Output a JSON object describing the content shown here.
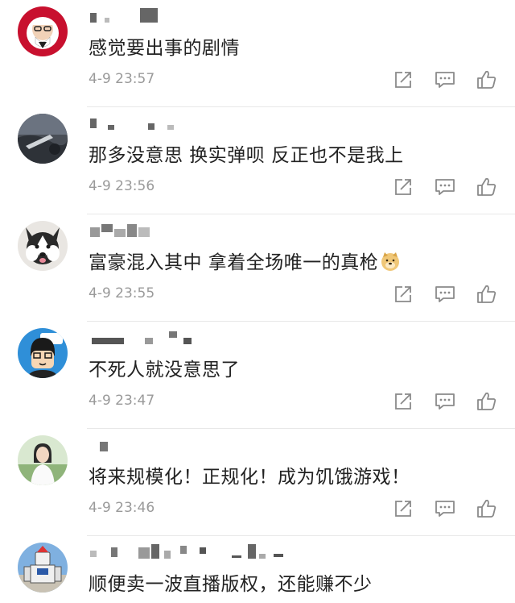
{
  "comments": [
    {
      "text": "感觉要出事的剧情",
      "time": "4-9 23:57",
      "avatar": "kfc-colonel-avatar"
    },
    {
      "text": "那多没意思 换实弹呗 反正也不是我上",
      "time": "4-9 23:56",
      "avatar": "dark-photo-avatar"
    },
    {
      "text": "富豪混入其中 拿着全场唯一的真枪",
      "time": "4-9 23:55",
      "avatar": "husky-dog-avatar",
      "emoji": "doge-emoji"
    },
    {
      "text": "不死人就没意思了",
      "time": "4-9 23:47",
      "avatar": "cartoon-boy-avatar"
    },
    {
      "text": "将来规模化！正规化！成为饥饿游戏！",
      "time": "4-9 23:46",
      "avatar": "woman-photo-avatar"
    },
    {
      "text": "顺便卖一波直播版权，还能赚不少",
      "time": "",
      "avatar": "robot-figure-avatar"
    }
  ],
  "icons": {
    "share": "share-icon",
    "reply": "reply-comment-icon",
    "like": "thumbs-up-icon"
  },
  "colors": {
    "text": "#222222",
    "meta": "#9a9a9a",
    "icon": "#8a8a8a",
    "divider": "#e8e8e8"
  }
}
